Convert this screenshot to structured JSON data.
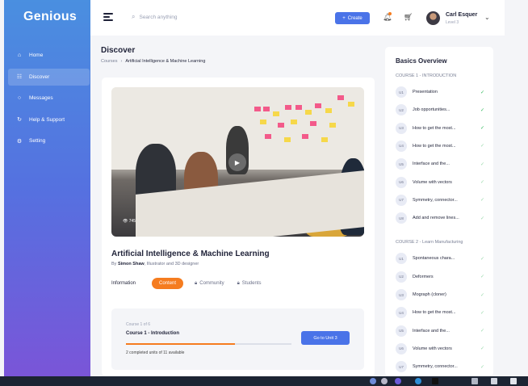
{
  "sidebar": {
    "logo": "Genious",
    "items": [
      {
        "icon": "home-icon",
        "glyph": "⌂",
        "label": "Home",
        "active": false
      },
      {
        "icon": "discover-icon",
        "glyph": "☷",
        "label": "Discover",
        "active": true
      },
      {
        "icon": "messages-icon",
        "glyph": "○",
        "label": "Messages",
        "active": false
      },
      {
        "icon": "help-icon",
        "glyph": "↻",
        "label": "Help & Support",
        "active": false
      },
      {
        "icon": "settings-icon",
        "glyph": "⚙",
        "label": "Setting",
        "active": false
      }
    ]
  },
  "header": {
    "search_placeholder": "Search anything",
    "create_label": "Create",
    "user_name": "Carl Esquer",
    "user_level": "Level 3"
  },
  "page": {
    "title": "Discover",
    "breadcrumb": [
      "Courses",
      "Artificial Intelligence & Machine Learning"
    ]
  },
  "course": {
    "video_views": "745",
    "title": "Artificial Intelligence & Machine Learning",
    "by_prefix": "By",
    "author": "Simon Shaw",
    "author_role": ", Illustrator and 3D designer",
    "tabs": [
      {
        "label": "Information",
        "active": false,
        "locked": false
      },
      {
        "label": "Content",
        "active": true,
        "locked": false
      },
      {
        "label": "Community",
        "active": false,
        "locked": true
      },
      {
        "label": "Students",
        "active": false,
        "locked": true
      }
    ],
    "progress": {
      "course_count": "Course 1 of 6",
      "unit_title": "Course 1 - Introduction",
      "fraction": 0.66,
      "note": "2 completed units of 11 available",
      "button": "Go to Unit 3"
    }
  },
  "overview": {
    "title": "Basics Overview",
    "sections": [
      {
        "heading": "COURSE 1 - INTRODUCTION",
        "lessons": [
          {
            "badge": "U1",
            "name": "Presentation",
            "done": true
          },
          {
            "badge": "U2",
            "name": "Job opportunities...",
            "done": true
          },
          {
            "badge": "U3",
            "name": "How to get the most...",
            "done": true
          },
          {
            "badge": "U4",
            "name": "How to get the most...",
            "done": false
          },
          {
            "badge": "U5",
            "name": "Interface and the...",
            "done": false
          },
          {
            "badge": "U6",
            "name": "Volume with vectors",
            "done": false
          },
          {
            "badge": "U7",
            "name": "Symmetry, connector...",
            "done": false
          },
          {
            "badge": "U8",
            "name": "Add and remove lines...",
            "done": false
          }
        ]
      },
      {
        "heading": "COURSE 2 - Learn Manufacturing",
        "lessons": [
          {
            "badge": "U1",
            "name": "Spontaneous chara...",
            "done": false
          },
          {
            "badge": "U2",
            "name": "Deformers",
            "done": false
          },
          {
            "badge": "U3",
            "name": "Mograph (cloner)",
            "done": false
          },
          {
            "badge": "U4",
            "name": "How to get the most...",
            "done": false
          },
          {
            "badge": "U5",
            "name": "Interface and the...",
            "done": false
          },
          {
            "badge": "U6",
            "name": "Volume with vectors",
            "done": false
          },
          {
            "badge": "U7",
            "name": "Symmetry, connector...",
            "done": false
          }
        ]
      }
    ]
  },
  "colors": {
    "accent": "#4a73e8",
    "orange": "#f57c1f",
    "check_done": "#2fb85a",
    "check_todo": "#9ad9ac"
  }
}
